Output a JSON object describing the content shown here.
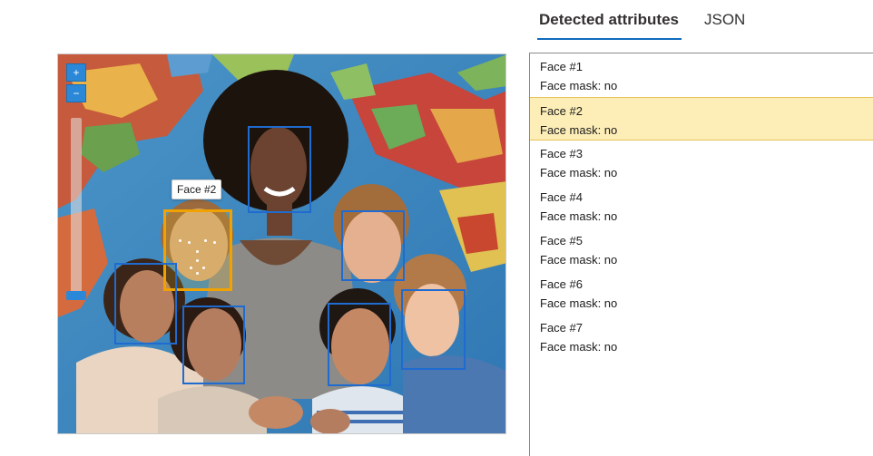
{
  "tabs": [
    {
      "label": "Detected attributes",
      "active": true
    },
    {
      "label": "JSON",
      "active": false
    }
  ],
  "viewer": {
    "zoom_in_label": "+",
    "zoom_out_label": "−",
    "zoom_level": 0.0,
    "selected_face": "Face #2",
    "tooltip": "Face #2"
  },
  "faces": [
    {
      "label": "Face #1",
      "mask_label": "Face mask: no",
      "selected": false
    },
    {
      "label": "Face #2",
      "mask_label": "Face mask: no",
      "selected": true
    },
    {
      "label": "Face #3",
      "mask_label": "Face mask: no",
      "selected": false
    },
    {
      "label": "Face #4",
      "mask_label": "Face mask: no",
      "selected": false
    },
    {
      "label": "Face #5",
      "mask_label": "Face mask: no",
      "selected": false
    },
    {
      "label": "Face #6",
      "mask_label": "Face mask: no",
      "selected": false
    },
    {
      "label": "Face #7",
      "mask_label": "Face mask: no",
      "selected": false
    }
  ],
  "colors": {
    "box": "#1f6bd0",
    "selected_box": "#f0a202",
    "selected_row": "#fdeeb8",
    "tab_underline": "#0f6cbd"
  }
}
